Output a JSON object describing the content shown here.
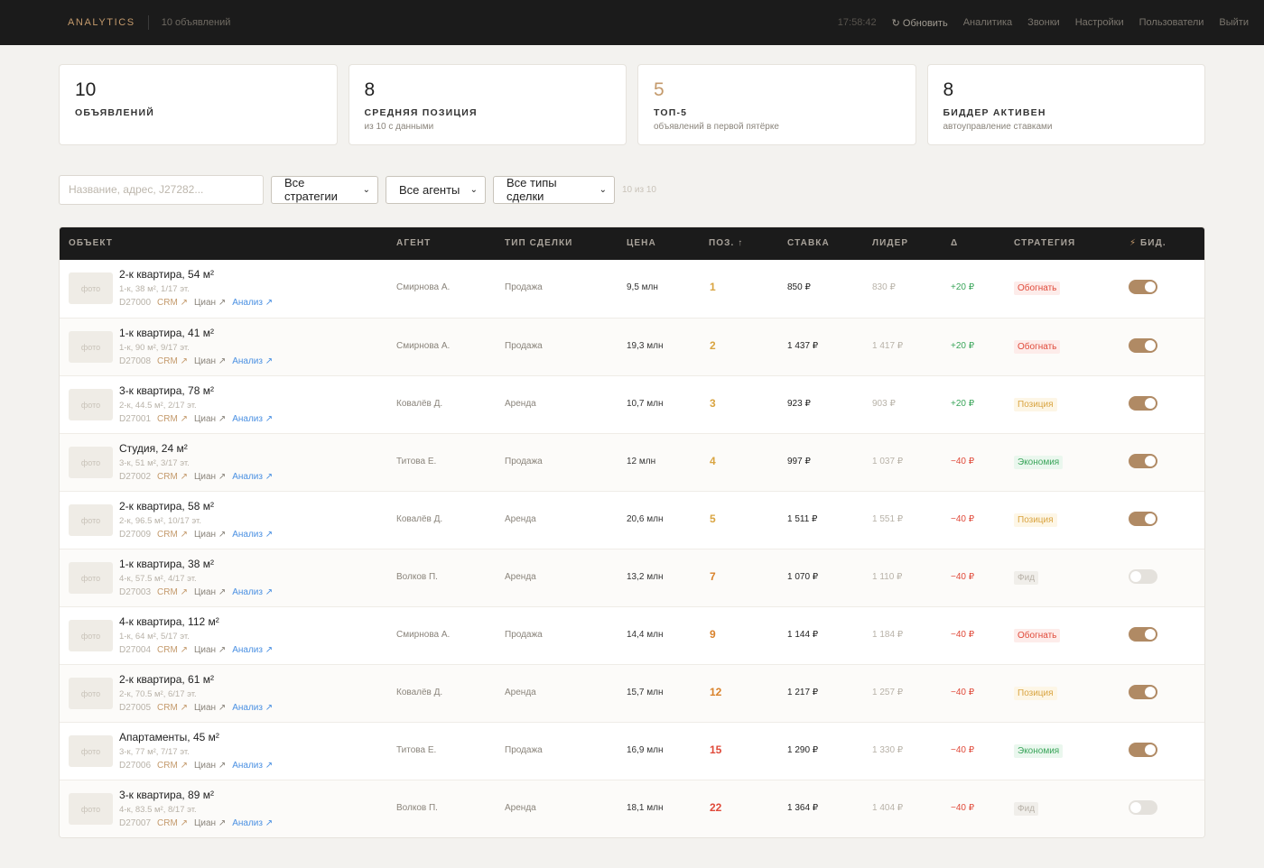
{
  "header": {
    "brand": "ANALYTICS",
    "subtitle": "10 объявлений",
    "time": "17:58:42",
    "refresh": "↻ Обновить",
    "nav": [
      "Аналитика",
      "Звонки",
      "Настройки",
      "Пользователи",
      "Выйти"
    ]
  },
  "stats": [
    {
      "value": "10",
      "label": "ОБЪЯВЛЕНИЙ",
      "sub": ""
    },
    {
      "value": "8",
      "label": "СРЕДНЯЯ ПОЗИЦИЯ",
      "sub": "из 10 с данными"
    },
    {
      "value": "5",
      "label": "ТОП-5",
      "sub": "объявлений в первой пятёрке"
    },
    {
      "value": "8",
      "label": "БИДДЕР АКТИВЕН",
      "sub": "автоуправление ставками"
    }
  ],
  "filters": {
    "search_placeholder": "Название, адрес, J27282...",
    "strategy": "Все стратегии",
    "agent": "Все агенты",
    "deal_type": "Все типы сделки",
    "count": "10 из 10"
  },
  "table": {
    "columns": [
      "ОБЪЕКТ",
      "АГЕНТ",
      "ТИП СДЕЛКИ",
      "ЦЕНА",
      "ПОЗ. ↑",
      "СТАВКА",
      "ЛИДЕР",
      "Δ",
      "СТРАТЕГИЯ",
      "БИД."
    ],
    "photo_label": "фото",
    "link_labels": {
      "crm": "CRM ↗",
      "cian": "Циан ↗",
      "analysis": "Анализ ↗"
    },
    "rows": [
      {
        "title": "2-к квартира, 54 м²",
        "meta": "1-к, 38 м², 1/17 эт.",
        "id": "D27000",
        "agent": "Смирнова А.",
        "deal": "Продажа",
        "price": "9,5 млн",
        "pos": "1",
        "bid": "850 ₽",
        "leader": "830 ₽",
        "delta": "+20 ₽",
        "strategy": "Обогнать",
        "bidder_on": true
      },
      {
        "title": "1-к квартира, 41 м²",
        "meta": "1-к, 90 м², 9/17 эт.",
        "id": "D27008",
        "agent": "Смирнова А.",
        "deal": "Продажа",
        "price": "19,3 млн",
        "pos": "2",
        "bid": "1 437 ₽",
        "leader": "1 417 ₽",
        "delta": "+20 ₽",
        "strategy": "Обогнать",
        "bidder_on": true
      },
      {
        "title": "3-к квартира, 78 м²",
        "meta": "2-к, 44.5 м², 2/17 эт.",
        "id": "D27001",
        "agent": "Ковалёв Д.",
        "deal": "Аренда",
        "price": "10,7 млн",
        "pos": "3",
        "bid": "923 ₽",
        "leader": "903 ₽",
        "delta": "+20 ₽",
        "strategy": "Позиция",
        "bidder_on": true
      },
      {
        "title": "Студия, 24 м²",
        "meta": "3-к, 51 м², 3/17 эт.",
        "id": "D27002",
        "agent": "Титова Е.",
        "deal": "Продажа",
        "price": "12 млн",
        "pos": "4",
        "bid": "997 ₽",
        "leader": "1 037 ₽",
        "delta": "−40 ₽",
        "strategy": "Экономия",
        "bidder_on": true
      },
      {
        "title": "2-к квартира, 58 м²",
        "meta": "2-к, 96.5 м², 10/17 эт.",
        "id": "D27009",
        "agent": "Ковалёв Д.",
        "deal": "Аренда",
        "price": "20,6 млн",
        "pos": "5",
        "bid": "1 511 ₽",
        "leader": "1 551 ₽",
        "delta": "−40 ₽",
        "strategy": "Позиция",
        "bidder_on": true
      },
      {
        "title": "1-к квартира, 38 м²",
        "meta": "4-к, 57.5 м², 4/17 эт.",
        "id": "D27003",
        "agent": "Волков П.",
        "deal": "Аренда",
        "price": "13,2 млн",
        "pos": "7",
        "bid": "1 070 ₽",
        "leader": "1 110 ₽",
        "delta": "−40 ₽",
        "strategy": "Фид",
        "bidder_on": false
      },
      {
        "title": "4-к квартира, 112 м²",
        "meta": "1-к, 64 м², 5/17 эт.",
        "id": "D27004",
        "agent": "Смирнова А.",
        "deal": "Продажа",
        "price": "14,4 млн",
        "pos": "9",
        "bid": "1 144 ₽",
        "leader": "1 184 ₽",
        "delta": "−40 ₽",
        "strategy": "Обогнать",
        "bidder_on": true
      },
      {
        "title": "2-к квартира, 61 м²",
        "meta": "2-к, 70.5 м², 6/17 эт.",
        "id": "D27005",
        "agent": "Ковалёв Д.",
        "deal": "Аренда",
        "price": "15,7 млн",
        "pos": "12",
        "bid": "1 217 ₽",
        "leader": "1 257 ₽",
        "delta": "−40 ₽",
        "strategy": "Позиция",
        "bidder_on": true
      },
      {
        "title": "Апартаменты, 45 м²",
        "meta": "3-к, 77 м², 7/17 эт.",
        "id": "D27006",
        "agent": "Титова Е.",
        "deal": "Продажа",
        "price": "16,9 млн",
        "pos": "15",
        "bid": "1 290 ₽",
        "leader": "1 330 ₽",
        "delta": "−40 ₽",
        "strategy": "Экономия",
        "bidder_on": true
      },
      {
        "title": "3-к квартира, 89 м²",
        "meta": "4-к, 83.5 м², 8/17 эт.",
        "id": "D27007",
        "agent": "Волков П.",
        "deal": "Аренда",
        "price": "18,1 млн",
        "pos": "22",
        "bid": "1 364 ₽",
        "leader": "1 404 ₽",
        "delta": "−40 ₽",
        "strategy": "Фид",
        "bidder_on": false
      }
    ]
  },
  "colors": {
    "accent": "#c49a6c",
    "topbar": "#1b1b1b",
    "toggle_on": "#b08a64"
  }
}
